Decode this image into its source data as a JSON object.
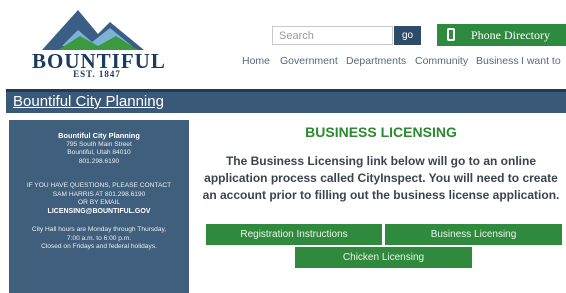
{
  "logo": {
    "wordmark": "BOUNTIFUL",
    "established": "EST. 1847",
    "colors": {
      "mountain_dark": "#3a5e86",
      "mountain_light": "#7fb1d4",
      "hill_green": "#3b9a3f",
      "text": "#1b3a5e"
    }
  },
  "search": {
    "placeholder": "Search",
    "go_label": "go"
  },
  "phone_directory": {
    "label": "Phone Directory",
    "icon": "phone-icon"
  },
  "nav": {
    "items": [
      "Home",
      "Government",
      "Departments",
      "Community",
      "Business",
      "I want to"
    ]
  },
  "section": {
    "title": "Bountiful City Planning"
  },
  "sidebar": {
    "title": "Bountiful City Planning",
    "address_1": "795 South Main Street",
    "address_2": "Bountiful, Utah 84010",
    "phone": "801.298.6190",
    "contact_1": "IF YOU HAVE QUESTIONS, PLEASE CONTACT",
    "contact_2": "SAM HARRIS AT 801.298.6190",
    "contact_3": "OR BY EMAIL",
    "email": "LICENSING@BOUNTIFUL.GOV",
    "hours_1": "City Hall hours are Monday through Thursday,",
    "hours_2": "7:00 a.m. to 6:00 p.m.",
    "hours_3": "Closed on Fridays and federal holidays."
  },
  "main": {
    "heading": "BUSINESS LICENSING",
    "body_1": "The Business Licensing link below will go to an online",
    "body_2": "application process called CityInspect.  You will need to create",
    "body_3": "an account prior to filling out the business license application."
  },
  "buttons": {
    "registration": "Registration Instructions",
    "business_licensing": "Business Licensing",
    "chicken_licensing": "Chicken Licensing"
  },
  "colors": {
    "navy": "#3a5978",
    "sidebar": "#3f5f7c",
    "green": "#2f8a3e",
    "heading_green": "#2b8a2f"
  }
}
